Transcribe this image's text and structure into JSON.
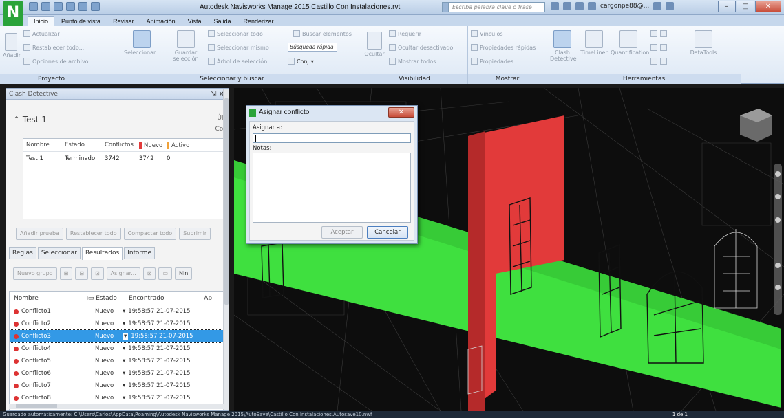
{
  "window": {
    "title": "Autodesk Navisworks Manage 2015   Castillo Con Instalaciones.rvt"
  },
  "search": {
    "placeholder": "Escriba palabra clave o frase"
  },
  "user": {
    "name": "cargonpe88@..."
  },
  "tabs": [
    "Inicio",
    "Punto de vista",
    "Revisar",
    "Animación",
    "Vista",
    "Salida",
    "Renderizar"
  ],
  "ribbon": {
    "proyecto": {
      "label": "Proyecto",
      "actualizar": "Actualizar",
      "restablecer": "Restablecer todo...",
      "opciones": "Opciones de archivo",
      "anadir": "Añadir"
    },
    "seleccionar": {
      "label": "Seleccionar y buscar",
      "seleccionar_btn": "Seleccionar...",
      "guardar": "Guardar selección",
      "sel_todo": "Seleccionar todo",
      "sel_mismo": "Seleccionar mismo",
      "arbol": "Árbol de selección",
      "buscar": "Buscar elementos",
      "busqueda_rapida": "Búsqueda rápida",
      "conj": "Conj"
    },
    "visibilidad": {
      "label": "Visibilidad",
      "ocultar": "Ocultar",
      "requerir": "Requerir",
      "ocultar_desactivado": "Ocultar desactivado",
      "mostrar_todos": "Mostrar todos"
    },
    "mostrar": {
      "label": "Mostrar",
      "vinculos": "Vínculos",
      "propiedades_rapidas": "Propiedades rápidas",
      "propiedades": "Propiedades"
    },
    "herramientas": {
      "label": "Herramientas",
      "clash": "Clash Detective",
      "timeliner": "TimeLiner",
      "quantification": "Quantification",
      "datatools": "DataTools"
    }
  },
  "clash_panel": {
    "title": "Clash Detective",
    "test_name": "Test 1",
    "test_right_1": "Últ",
    "test_right_2": "Cor",
    "tests_table": {
      "headers": [
        "Nombre",
        "Estado",
        "Conflictos",
        "Nuevo",
        "Activo"
      ],
      "rows": [
        [
          "Test 1",
          "Terminado",
          "3742",
          "3742",
          "0"
        ]
      ]
    },
    "buttons": [
      "Añadir prueba",
      "Restablecer todo",
      "Compactar todo",
      "Suprimir"
    ],
    "subtabs": [
      "Reglas",
      "Seleccionar",
      "Resultados",
      "Informe"
    ],
    "toolbar": {
      "nuevo_grupo": "Nuevo grupo",
      "asignar": "Asignar...",
      "ninguno": "Nin"
    },
    "results": {
      "headers": [
        "Nombre",
        "Estado",
        "Encontrado",
        "Ap"
      ],
      "rows": [
        {
          "name": "Conflicto1",
          "estado": "Nuevo",
          "found": "19:58:57 21-07-2015"
        },
        {
          "name": "Conflicto2",
          "estado": "Nuevo",
          "found": "19:58:57 21-07-2015"
        },
        {
          "name": "Conflicto3",
          "estado": "Nuevo",
          "found": "19:58:57 21-07-2015"
        },
        {
          "name": "Conflicto4",
          "estado": "Nuevo",
          "found": "19:58:57 21-07-2015"
        },
        {
          "name": "Conflicto5",
          "estado": "Nuevo",
          "found": "19:58:57 21-07-2015"
        },
        {
          "name": "Conflicto6",
          "estado": "Nuevo",
          "found": "19:58:57 21-07-2015"
        },
        {
          "name": "Conflicto7",
          "estado": "Nuevo",
          "found": "19:58:57 21-07-2015"
        },
        {
          "name": "Conflicto8",
          "estado": "Nuevo",
          "found": "19:58:57 21-07-2015"
        }
      ]
    }
  },
  "dialog": {
    "title": "Asignar conflicto",
    "asignar_label": "Asignar a:",
    "notas_label": "Notas:",
    "aceptar": "Aceptar",
    "cancelar": "Cancelar"
  },
  "status": {
    "text": "Guardado automáticamente: C:\\Users\\Carlos\\AppData\\Roaming\\Autodesk Navisworks Manage 2015\\AutoSave\\Castillo Con Instalaciones.Autosave10.nwf",
    "page": "1 de 1"
  },
  "colors": {
    "accent": "#3399e6",
    "clash_red": "#e23a3a",
    "duct_green": "#3fe03f"
  }
}
